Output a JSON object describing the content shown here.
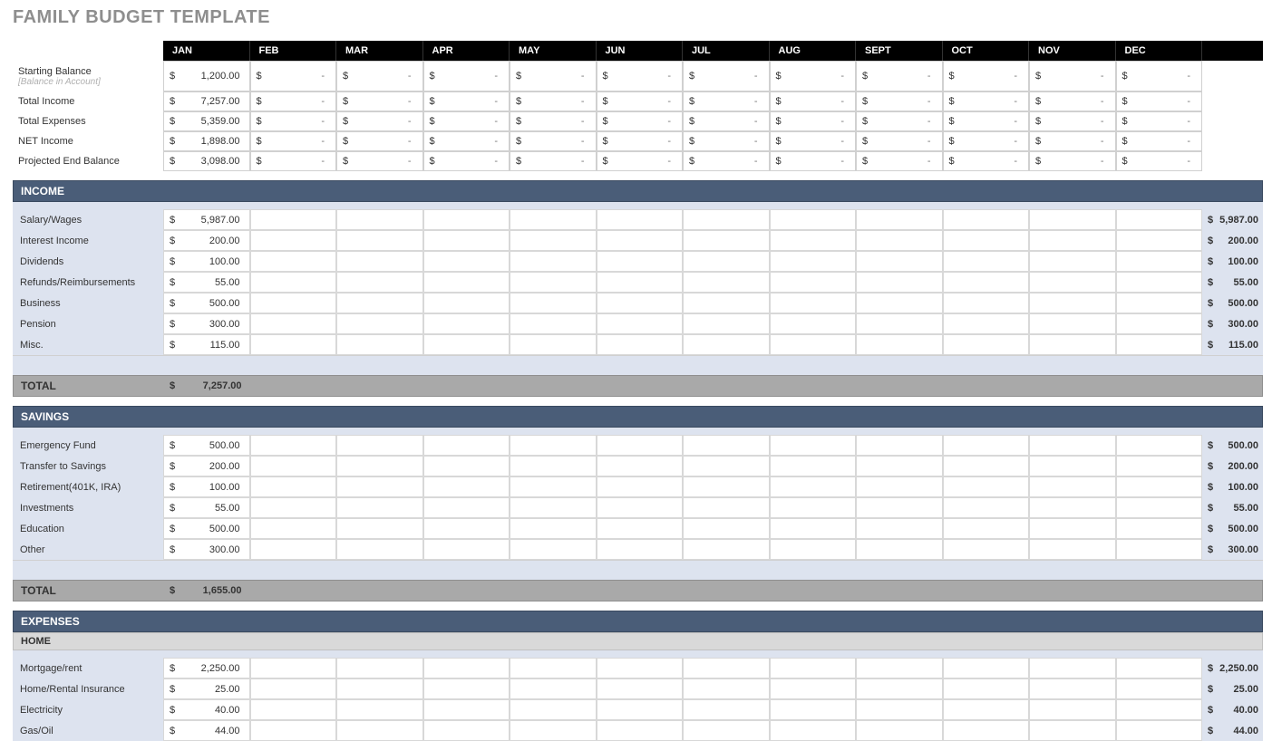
{
  "title": "FAMILY BUDGET TEMPLATE",
  "months": [
    "JAN",
    "FEB",
    "MAR",
    "APR",
    "MAY",
    "JUN",
    "JUL",
    "AUG",
    "SEPT",
    "OCT",
    "NOV",
    "DEC"
  ],
  "summary": [
    {
      "label": "Starting Balance",
      "sublabel": "[Balance in Account]",
      "values": [
        "1,200.00",
        "-",
        "-",
        "-",
        "-",
        "-",
        "-",
        "-",
        "-",
        "-",
        "-",
        "-"
      ]
    },
    {
      "label": "Total Income",
      "values": [
        "7,257.00",
        "-",
        "-",
        "-",
        "-",
        "-",
        "-",
        "-",
        "-",
        "-",
        "-",
        "-"
      ]
    },
    {
      "label": "Total Expenses",
      "values": [
        "5,359.00",
        "-",
        "-",
        "-",
        "-",
        "-",
        "-",
        "-",
        "-",
        "-",
        "-",
        "-"
      ]
    },
    {
      "label": "NET Income",
      "values": [
        "1,898.00",
        "-",
        "-",
        "-",
        "-",
        "-",
        "-",
        "-",
        "-",
        "-",
        "-",
        "-"
      ]
    },
    {
      "label": "Projected End Balance",
      "values": [
        "3,098.00",
        "-",
        "-",
        "-",
        "-",
        "-",
        "-",
        "-",
        "-",
        "-",
        "-",
        "-"
      ]
    }
  ],
  "sections": [
    {
      "title": "INCOME",
      "rows": [
        {
          "label": "Salary/Wages",
          "jan": "5,987.00",
          "total": "5,987.00"
        },
        {
          "label": "Interest Income",
          "jan": "200.00",
          "total": "200.00"
        },
        {
          "label": "Dividends",
          "jan": "100.00",
          "total": "100.00"
        },
        {
          "label": "Refunds/Reimbursements",
          "jan": "55.00",
          "total": "55.00"
        },
        {
          "label": "Business",
          "jan": "500.00",
          "total": "500.00"
        },
        {
          "label": "Pension",
          "jan": "300.00",
          "total": "300.00"
        },
        {
          "label": "Misc.",
          "jan": "115.00",
          "total": "115.00"
        }
      ],
      "total_label": "TOTAL",
      "total": "7,257.00"
    },
    {
      "title": "SAVINGS",
      "rows": [
        {
          "label": "Emergency Fund",
          "jan": "500.00",
          "total": "500.00"
        },
        {
          "label": "Transfer to Savings",
          "jan": "200.00",
          "total": "200.00"
        },
        {
          "label": "Retirement(401K, IRA)",
          "jan": "100.00",
          "total": "100.00"
        },
        {
          "label": "Investments",
          "jan": "55.00",
          "total": "55.00"
        },
        {
          "label": "Education",
          "jan": "500.00",
          "total": "500.00"
        },
        {
          "label": "Other",
          "jan": "300.00",
          "total": "300.00"
        }
      ],
      "total_label": "TOTAL",
      "total": "1,655.00"
    },
    {
      "title": "EXPENSES",
      "sublabel": "HOME",
      "rows": [
        {
          "label": "Mortgage/rent",
          "jan": "2,250.00",
          "total": "2,250.00"
        },
        {
          "label": "Home/Rental Insurance",
          "jan": "25.00",
          "total": "25.00"
        },
        {
          "label": "Electricity",
          "jan": "40.00",
          "total": "40.00"
        },
        {
          "label": "Gas/Oil",
          "jan": "44.00",
          "total": "44.00"
        }
      ]
    }
  ]
}
